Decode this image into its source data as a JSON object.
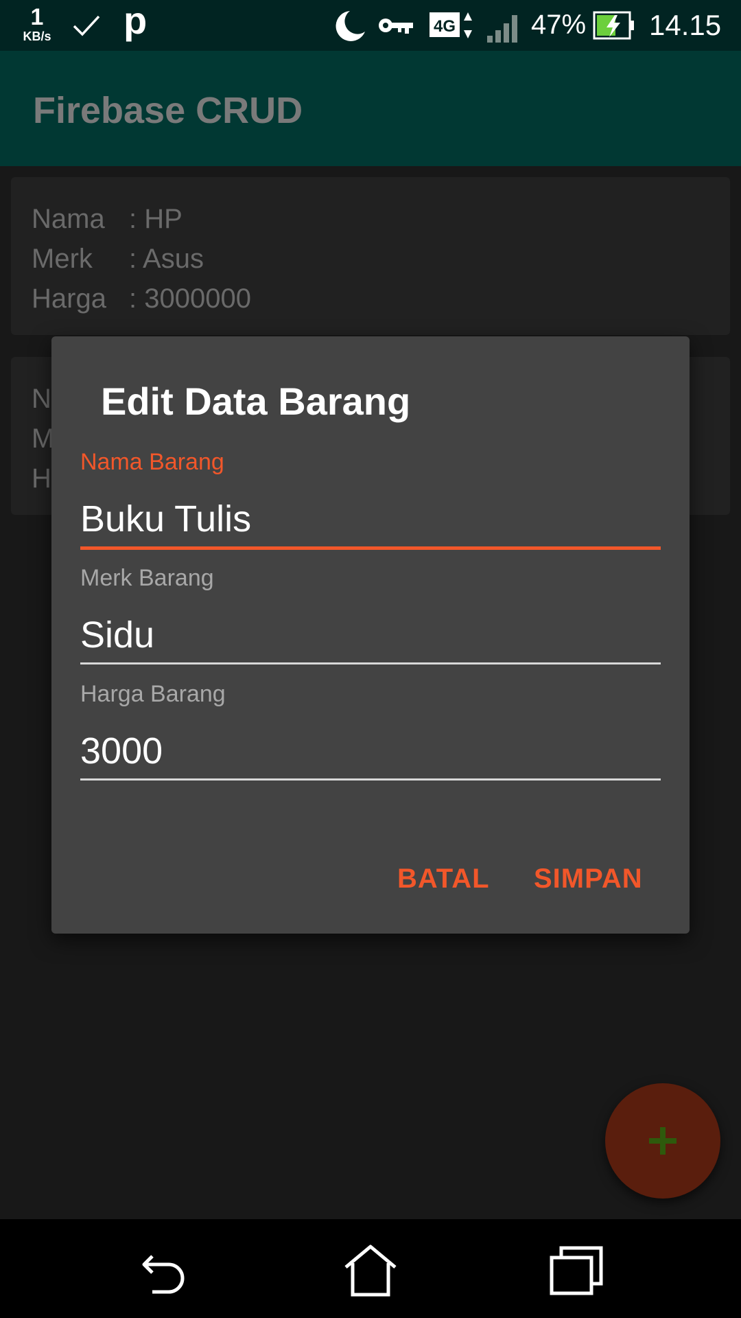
{
  "status_bar": {
    "net_speed_value": "1",
    "net_speed_unit": "KB/s",
    "p_icon_text": "p",
    "battery_percent": "47%",
    "time": "14.15",
    "network_type": "4G",
    "icons": [
      "check-icon",
      "moon-icon",
      "vpn-key-icon",
      "network-4g-icon",
      "signal-icon",
      "battery-charging-icon"
    ]
  },
  "app_bar": {
    "title": "Firebase CRUD"
  },
  "list": [
    {
      "rows": [
        {
          "label": "Nama",
          "value": ": HP"
        },
        {
          "label": "Merk",
          "value": ": Asus"
        },
        {
          "label": "Harga",
          "value": ": 3000000"
        }
      ]
    },
    {
      "rows": [
        {
          "label": "N",
          "value": ""
        },
        {
          "label": "M",
          "value": ""
        },
        {
          "label": "H",
          "value": ""
        }
      ]
    }
  ],
  "dialog": {
    "title": "Edit Data Barang",
    "fields": [
      {
        "label": "Nama Barang",
        "value": "Buku Tulis",
        "focused": true
      },
      {
        "label": "Merk Barang",
        "value": "Sidu",
        "focused": false
      },
      {
        "label": "Harga Barang",
        "value": "3000",
        "focused": false
      }
    ],
    "cancel_label": "BATAL",
    "save_label": "SIMPAN"
  },
  "fab": {
    "icon": "plus-icon"
  },
  "nav_bar": {
    "icons": [
      "back-icon",
      "home-icon",
      "recent-apps-icon"
    ]
  },
  "colors": {
    "accent": "#f2572a",
    "app_bar": "#013833",
    "status_bar": "#012422",
    "dialog_bg": "#434343",
    "fab_bg": "#5a1e0d",
    "fab_icon": "#2e5a0c"
  }
}
